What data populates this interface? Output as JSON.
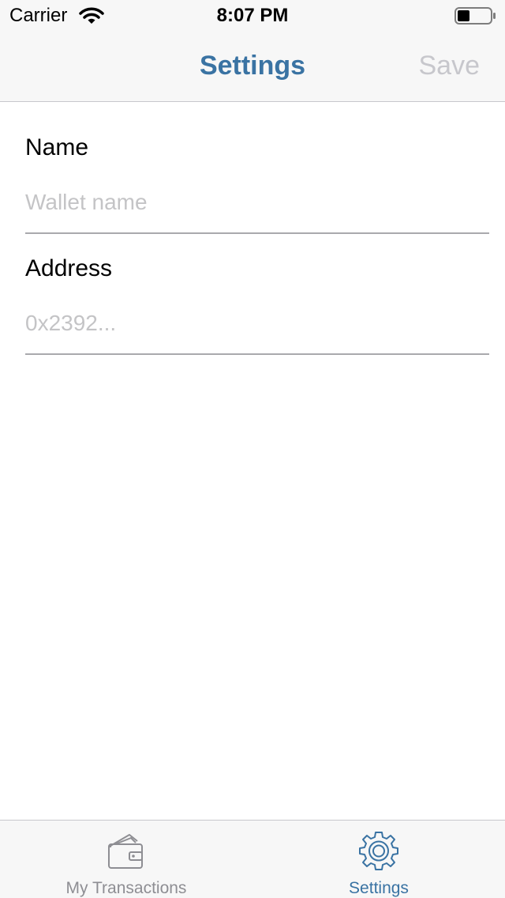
{
  "status_bar": {
    "carrier": "Carrier",
    "time": "8:07 PM",
    "wifi_icon": "wifi-icon",
    "battery_icon": "battery-icon"
  },
  "nav": {
    "title": "Settings",
    "save_label": "Save"
  },
  "form": {
    "name": {
      "label": "Name",
      "value": "",
      "placeholder": "Wallet name"
    },
    "address": {
      "label": "Address",
      "value": "",
      "placeholder": "0x2392..."
    }
  },
  "tab_bar": {
    "tabs": [
      {
        "label": "My Transactions",
        "icon": "wallet-icon",
        "active": false
      },
      {
        "label": "Settings",
        "icon": "gear-icon",
        "active": true
      }
    ]
  },
  "colors": {
    "accent": "#3a73a3",
    "disabled": "#c7c7cc",
    "placeholder": "#c4c4c6",
    "inactive_tab": "#8e8e93",
    "bar_background": "#f7f7f7"
  }
}
